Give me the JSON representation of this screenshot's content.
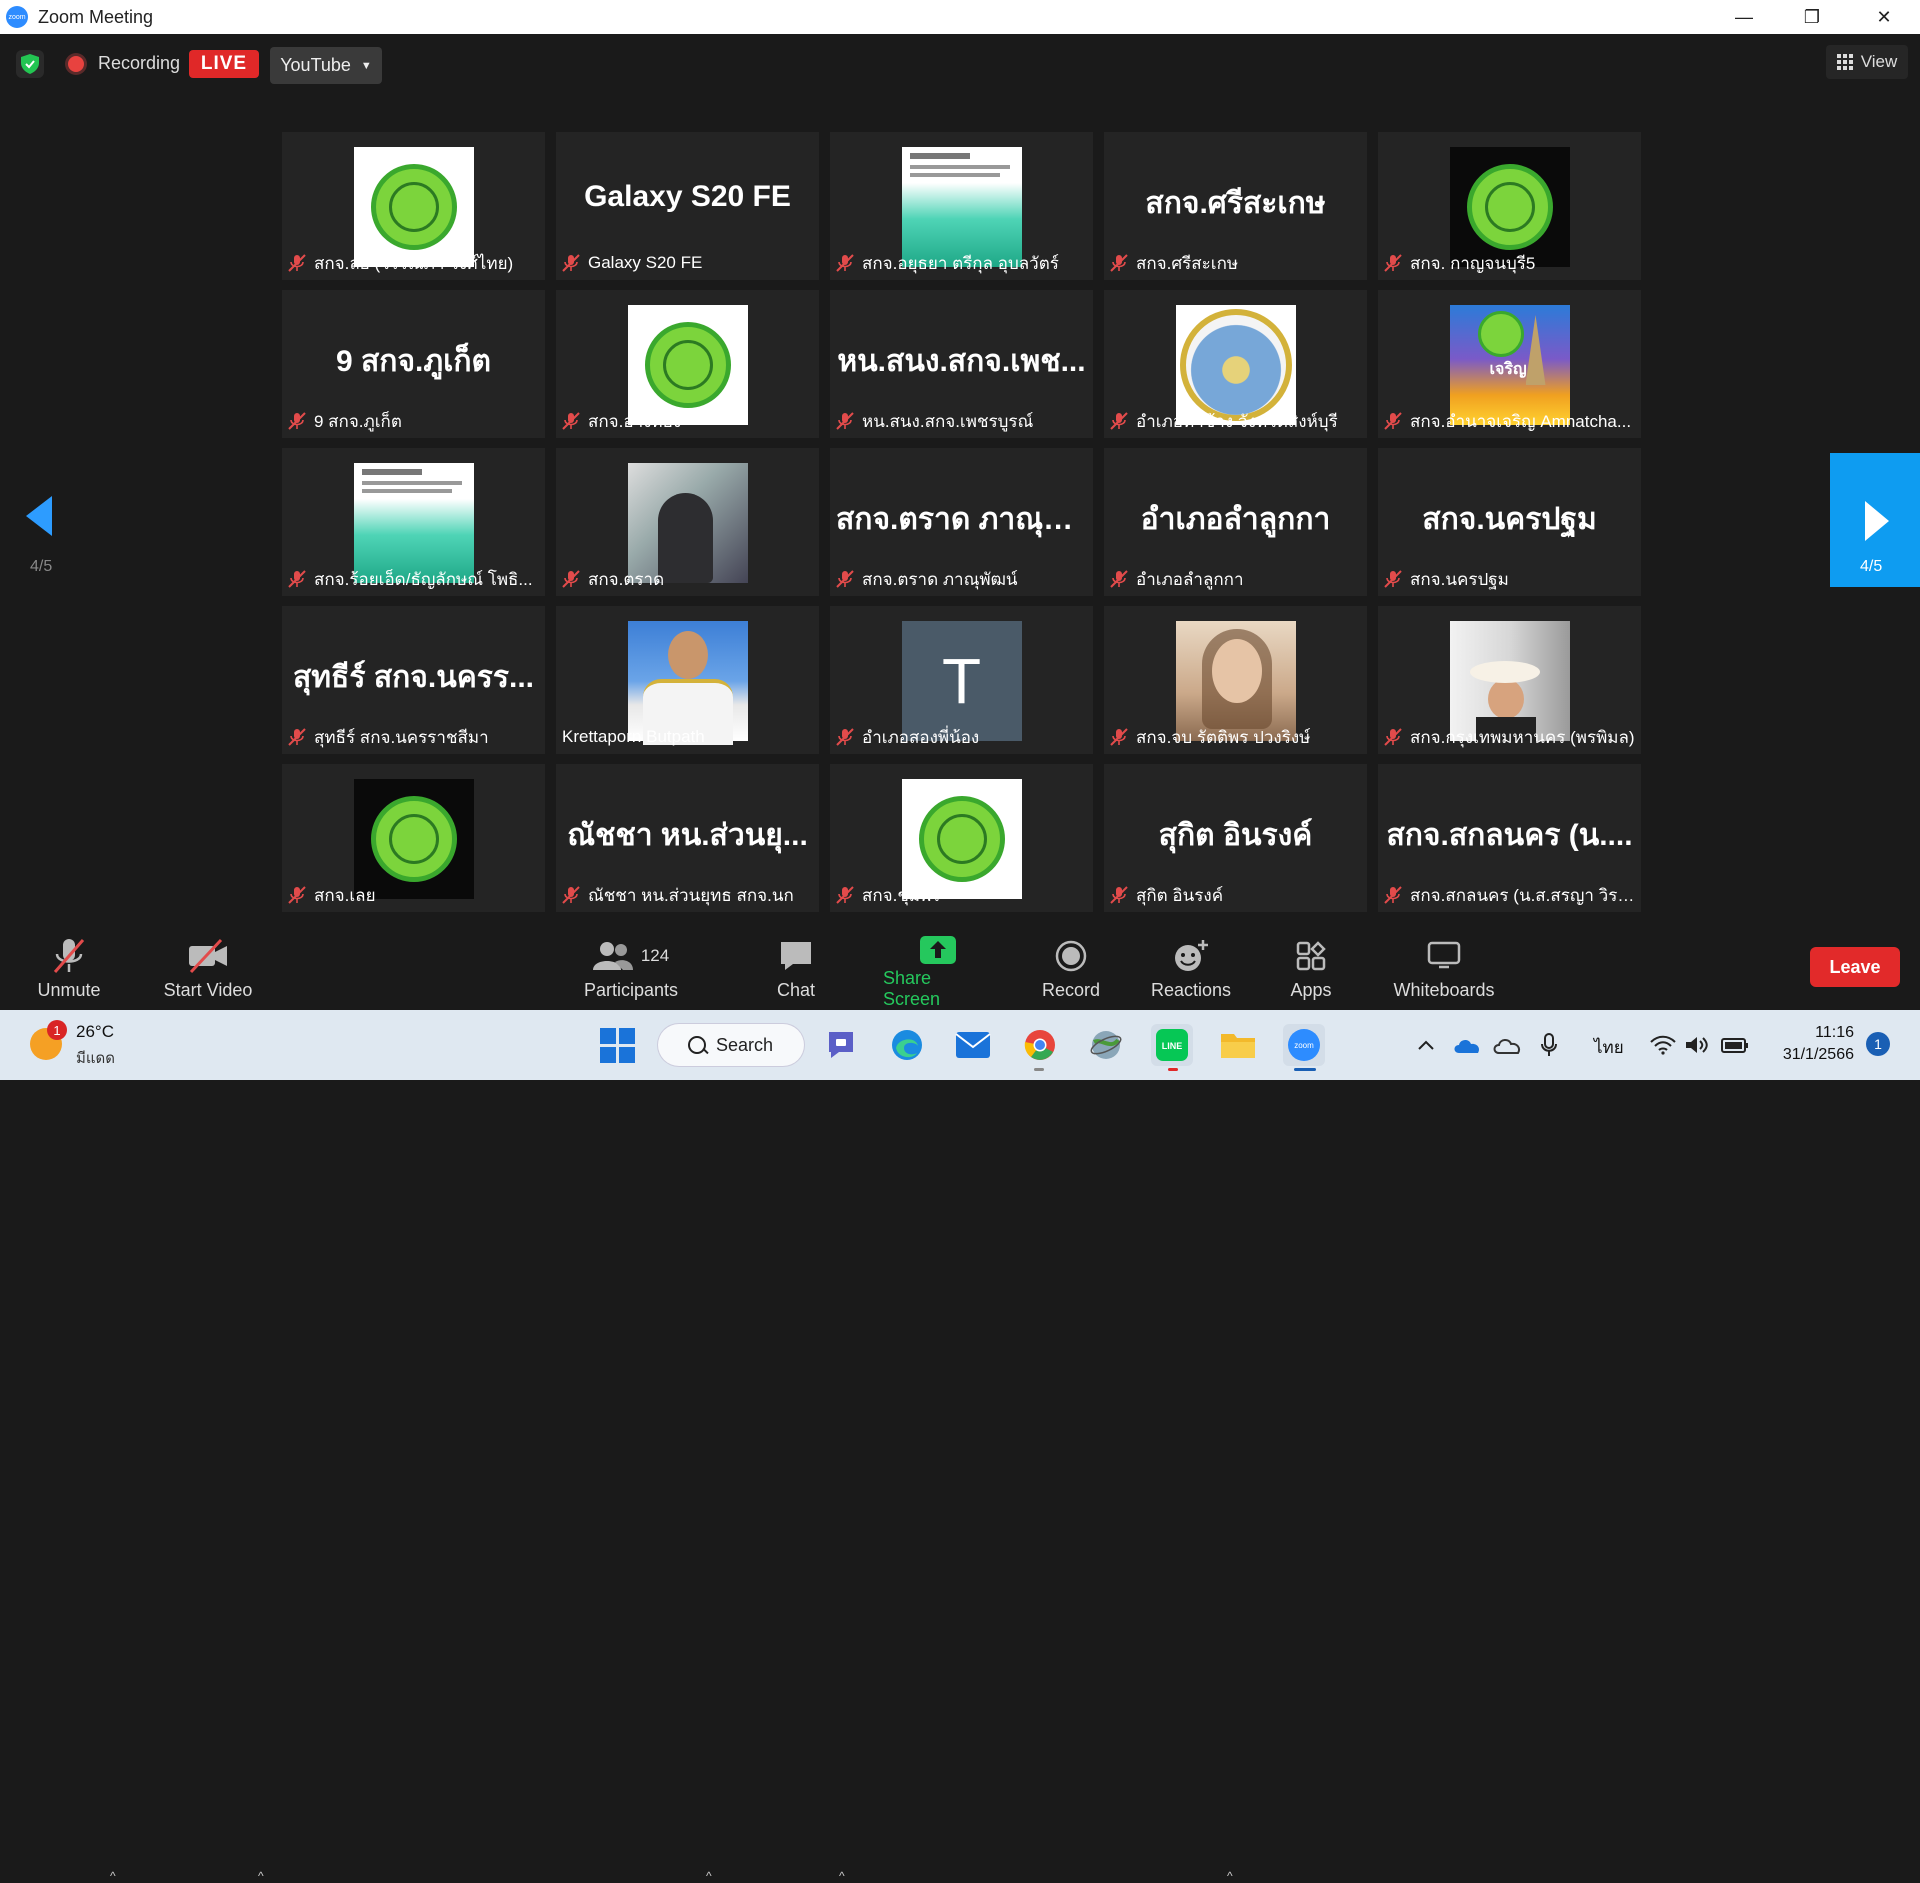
{
  "window": {
    "title": "Zoom Meeting",
    "minimize": "—",
    "restore": "❐",
    "close": "✕",
    "logo_text": "zoom"
  },
  "topbar": {
    "recording_label": "Recording",
    "live_label": "LIVE",
    "stream_target": "YouTube",
    "view_label": "View"
  },
  "pagination": {
    "left": "4/5",
    "right": "4/5"
  },
  "tiles": [
    {
      "label": "สกจ.ลย (วรรณภา วงศ์ไทย)",
      "display": "",
      "avatar": "logo-white",
      "muted": true
    },
    {
      "label": "Galaxy S20 FE",
      "display": "Galaxy S20 FE",
      "avatar": "none",
      "muted": true
    },
    {
      "label": "สกจ.อยุธยา ตรีกุล อุบลวัตร์",
      "display": "",
      "avatar": "phone",
      "muted": true
    },
    {
      "label": "สกจ.ศรีสะเกษ",
      "display": "สกจ.ศรีสะเกษ",
      "avatar": "none",
      "muted": true
    },
    {
      "label": "สกจ. กาญจนบุรี5",
      "display": "",
      "avatar": "logo-black",
      "muted": true
    },
    {
      "label": "9 สกจ.ภูเก็ต",
      "display": "9 สกจ.ภูเก็ต",
      "avatar": "none",
      "muted": true
    },
    {
      "label": "สกจ.อ่างทอง",
      "display": "",
      "avatar": "logo-white",
      "muted": true
    },
    {
      "label": "หน.สนง.สกจ.เพชรบูรณ์",
      "display": "หน.สนง.สกจ.เพช...",
      "avatar": "none",
      "muted": true
    },
    {
      "label": "อำเภอท่าช้าง จังหวัดสิงห์บุรี",
      "display": "",
      "avatar": "thachang",
      "muted": true
    },
    {
      "label": "สกจ.อำนาจเจริญ Amnatcha...",
      "display": "",
      "avatar": "amnat",
      "muted": true,
      "avatar_text": "เจริญ"
    },
    {
      "label": "สกจ.ร้อยเอ็ด/ธัญลักษณ์ โพธิ...",
      "display": "",
      "avatar": "phone",
      "muted": true
    },
    {
      "label": "สกจ.ตราด",
      "display": "",
      "avatar": "photo-a",
      "muted": true
    },
    {
      "label": "สกจ.ตราด ภาณุพัฒน์",
      "display": "สกจ.ตราด ภาณุพั...",
      "avatar": "none",
      "muted": true
    },
    {
      "label": "อำเภอลำลูกกา",
      "display": "อำเภอลำลูกกา",
      "avatar": "none",
      "muted": true
    },
    {
      "label": "สกจ.นครปฐม",
      "display": "สกจ.นครปฐม",
      "avatar": "none",
      "muted": true
    },
    {
      "label": "สุทธีร์ สกจ.นครราชสีมา",
      "display": "สุทธีร์ สกจ.นครร...",
      "avatar": "none",
      "muted": true
    },
    {
      "label": "Krettaporn Butpath",
      "display": "",
      "avatar": "photo-b",
      "muted": false
    },
    {
      "label": "อำเภอสองพี่น้อง",
      "display": "",
      "avatar": "letter",
      "muted": true,
      "avatar_text": "T"
    },
    {
      "label": "สกจ.จบ รัตติพร ปวงริงษ์",
      "display": "",
      "avatar": "photo-c",
      "muted": true
    },
    {
      "label": "สกจ.กรุงเทพมหานคร (พรพิมล)",
      "display": "",
      "avatar": "photo-d",
      "muted": true
    },
    {
      "label": "สกจ.เลย",
      "display": "",
      "avatar": "logo-black",
      "muted": true
    },
    {
      "label": "ณัชชา หน.ส่วนยุทธ สกจ.นก",
      "display": "ณัชชา หน.ส่วนยุ...",
      "avatar": "none",
      "muted": true
    },
    {
      "label": "สกจ.ชุมพร",
      "display": "",
      "avatar": "logo-white",
      "muted": true
    },
    {
      "label": "สุกิต อินรงค์",
      "display": "สุกิต อินรงค์",
      "avatar": "none",
      "muted": true
    },
    {
      "label": "สกจ.สกลนคร (น.ส.สรญา วิรง...",
      "display": "สกจ.สกลนคร (น....",
      "avatar": "none",
      "muted": true
    }
  ],
  "toolbar": {
    "unmute": "Unmute",
    "start_video": "Start Video",
    "participants": "Participants",
    "participants_count": "124",
    "chat": "Chat",
    "share_screen": "Share Screen",
    "record": "Record",
    "reactions": "Reactions",
    "apps": "Apps",
    "whiteboards": "Whiteboards",
    "leave": "Leave"
  },
  "taskbar": {
    "temperature": "26°C",
    "condition": "มีแดด",
    "weather_badge": "1",
    "search": "Search",
    "language": "ไทย",
    "time": "11:16",
    "date": "31/1/2566",
    "notifications": "1",
    "line_label": "LINE",
    "zoom_label": "zoom"
  },
  "colors": {
    "accent_blue": "#0e9cf1",
    "live_red": "#e02828",
    "share_green": "#25c85d",
    "muted_red": "#e24b4b"
  }
}
